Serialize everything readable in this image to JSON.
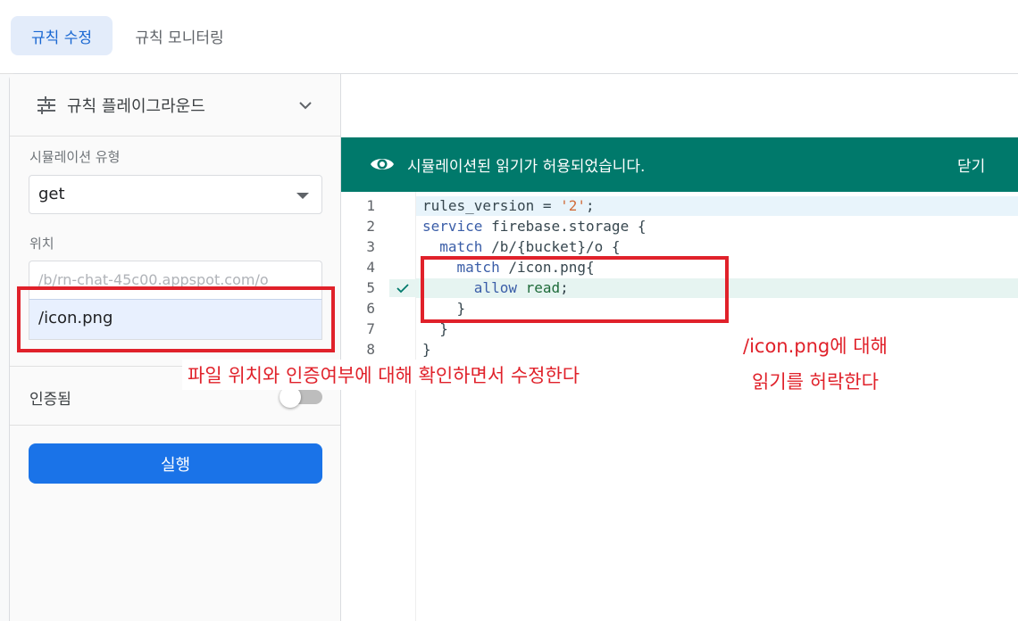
{
  "tabs": [
    {
      "label": "규칙 수정",
      "active": true
    },
    {
      "label": "규칙 모니터링",
      "active": false
    }
  ],
  "playground": {
    "title": "규칙 플레이그라운드",
    "sim_type_label": "시뮬레이션 유형",
    "sim_type_value": "get",
    "location_label": "위치",
    "location_prefix": "/b/rn-chat-45c00.appspot.com/o",
    "location_path": "/icon.png",
    "auth_label": "인증됨",
    "auth_enabled": false,
    "run_label": "실행"
  },
  "banner": {
    "message": "시뮬레이션된 읽기가 허용되었습니다.",
    "close_label": "닫기",
    "color": "#00796b"
  },
  "editor": {
    "line_numbers": [
      "1",
      "2",
      "3",
      "4",
      "5",
      "6",
      "7",
      "8"
    ],
    "lines": [
      "rules_version = '2';",
      "service firebase.storage {",
      "  match /b/{bucket}/o {",
      "    match /icon.png{",
      "      allow read;",
      "    }",
      "  }",
      "}"
    ],
    "highlighted_line": 5
  },
  "annotations": {
    "left_note": "파일 위치와 인증여부에 대해 확인하면서 수정한다",
    "right_note_line1": "/icon.png에 대해",
    "right_note_line2": "읽기를 허락한다",
    "color": "#e0212a"
  }
}
